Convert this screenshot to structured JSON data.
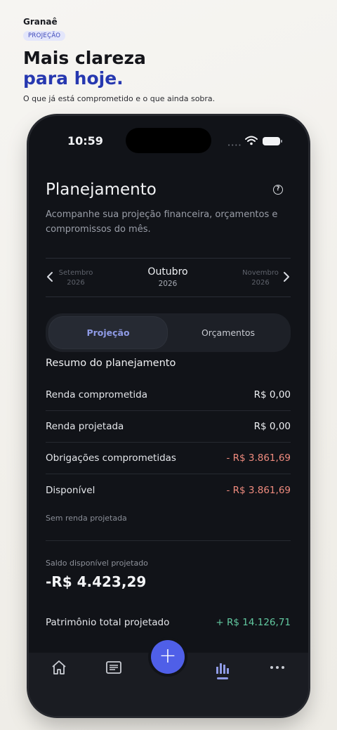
{
  "hero": {
    "brand": "Granaê",
    "tag": "PROJEÇÃO",
    "headline_line1": "Mais clareza",
    "headline_line2": "para hoje.",
    "subtitle": "O que já está comprometido e o que ainda sobra."
  },
  "status_bar": {
    "time": "10:59",
    "signal": "••••"
  },
  "screen": {
    "title": "Planejamento",
    "help_glyph": "?",
    "description": "Acompanhe sua projeção financeira, orçamentos e compromissos do mês."
  },
  "months": {
    "prev": {
      "name": "Setembro",
      "year": "2026"
    },
    "current": {
      "name": "Outubro",
      "year": "2026"
    },
    "next": {
      "name": "Novembro",
      "year": "2026"
    }
  },
  "segmented": {
    "active": "Projeção",
    "inactive": "Orçamentos"
  },
  "summary": {
    "title": "Resumo do planejamento",
    "rows": [
      {
        "label": "Renda comprometida",
        "value": "R$ 0,00"
      },
      {
        "label": "Renda projetada",
        "value": "R$ 0,00"
      },
      {
        "label": "Obrigações comprometidas",
        "value": "- R$ 3.861,69"
      },
      {
        "label": "Disponível",
        "value": "- R$ 3.861,69"
      }
    ],
    "note": "Sem renda projetada"
  },
  "saldo": {
    "label": "Saldo disponível projetado",
    "value": "-R$ 4.423,29"
  },
  "patrimonio": {
    "label": "Patrimônio total projetado",
    "value": "+ R$ 14.126,71"
  },
  "fab_glyph": "+",
  "tabs": [
    "home-icon",
    "list-icon",
    "add-icon",
    "chart-icon",
    "more-icon"
  ],
  "colors": {
    "accent": "#4f5fe8",
    "negative": "#ef8b7e",
    "positive": "#62c9a0",
    "headline_accent": "#2638b0"
  }
}
